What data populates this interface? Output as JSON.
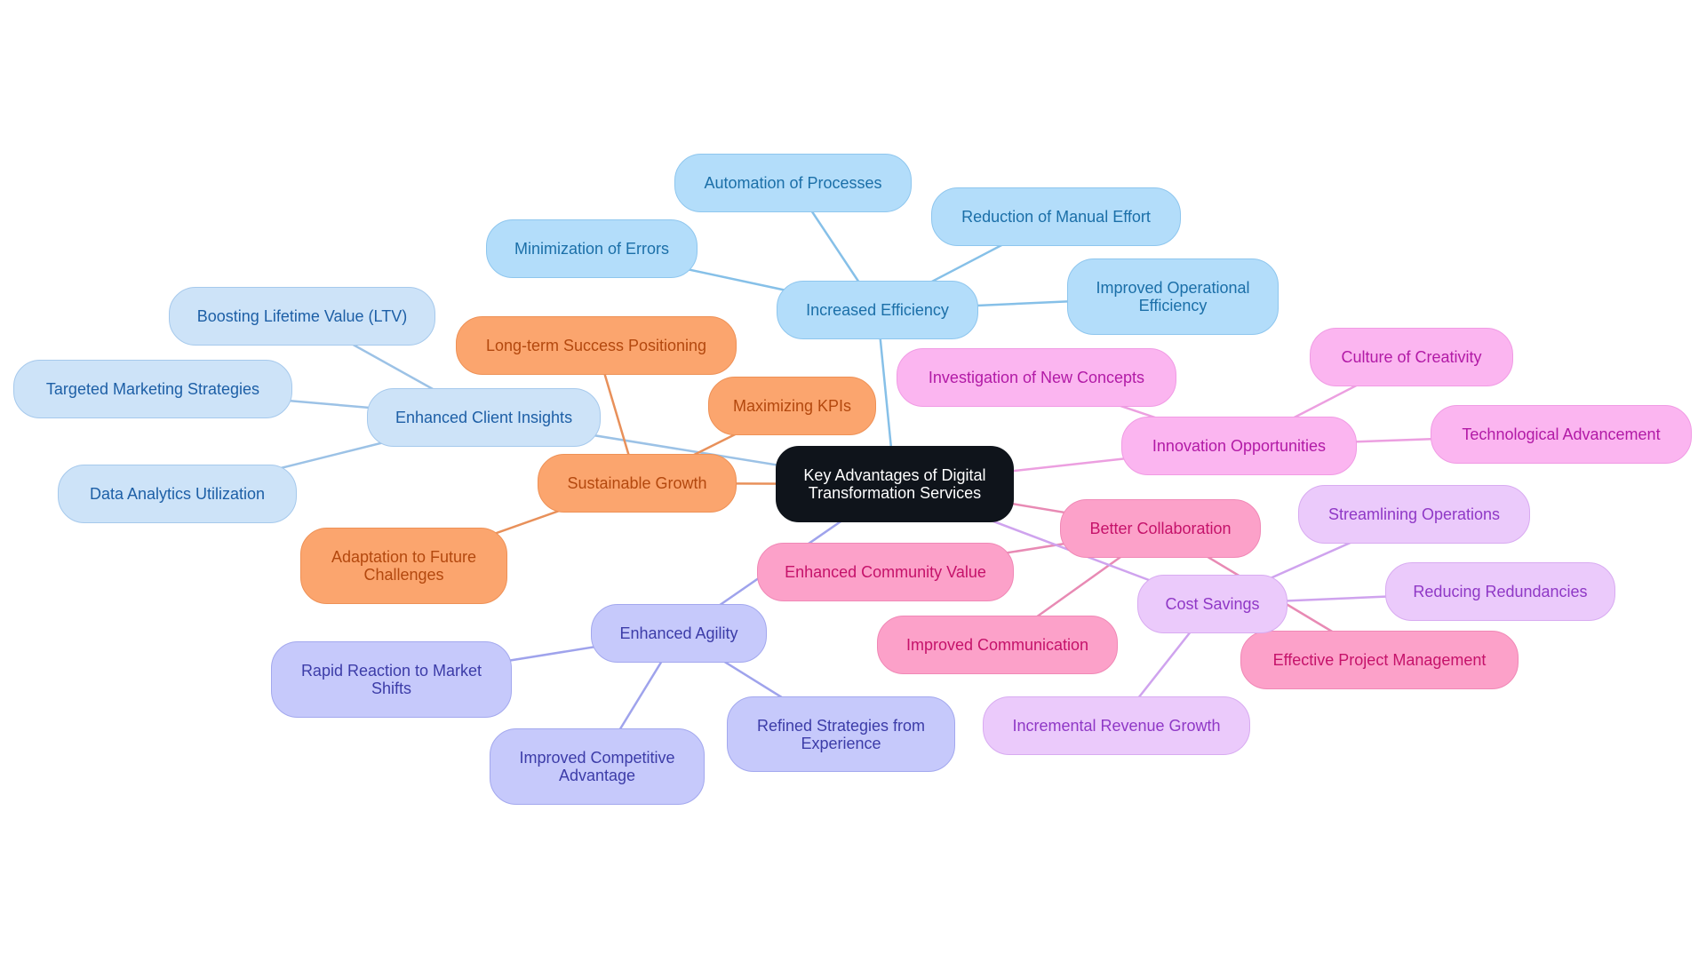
{
  "diagram": {
    "type": "mind-map",
    "root": {
      "id": "root",
      "label": "Key Advantages of Digital\nTransformation Services"
    },
    "colors": {
      "blue": "#b3ddfa",
      "lblue": "#cde3f8",
      "orange": "#fba56e",
      "indigo": "#c6c9fb",
      "magenta": "#fbb5f0",
      "pink": "#fca1c9",
      "lilac": "#ebcafb",
      "root": "#0f141b",
      "edge_blue": "#86c0e8",
      "edge_lblue": "#9cc2e6",
      "edge_orange": "#e8905a",
      "edge_indigo": "#9fa3ec",
      "edge_magenta": "#ec9fe0",
      "edge_pink": "#e88ab4",
      "edge_lilac": "#cfa3ee"
    },
    "nodes": [
      {
        "id": "eff",
        "label": "Increased Efficiency",
        "parent": "root",
        "color": "blue"
      },
      {
        "id": "eff1",
        "label": "Automation of Processes",
        "parent": "eff",
        "color": "blue"
      },
      {
        "id": "eff2",
        "label": "Reduction of Manual Effort",
        "parent": "eff",
        "color": "blue"
      },
      {
        "id": "eff3",
        "label": "Minimization of Errors",
        "parent": "eff",
        "color": "blue"
      },
      {
        "id": "eff4",
        "label": "Improved Operational\nEfficiency",
        "parent": "eff",
        "color": "blue"
      },
      {
        "id": "eci",
        "label": "Enhanced Client Insights",
        "parent": "root",
        "color": "lblue"
      },
      {
        "id": "eci1",
        "label": "Boosting Lifetime Value (LTV)",
        "parent": "eci",
        "color": "lblue"
      },
      {
        "id": "eci2",
        "label": "Targeted Marketing Strategies",
        "parent": "eci",
        "color": "lblue"
      },
      {
        "id": "eci3",
        "label": "Data Analytics Utilization",
        "parent": "eci",
        "color": "lblue"
      },
      {
        "id": "sg",
        "label": "Sustainable Growth",
        "parent": "root",
        "color": "orange"
      },
      {
        "id": "sg1",
        "label": "Long-term Success Positioning",
        "parent": "sg",
        "color": "orange"
      },
      {
        "id": "sg2",
        "label": "Maximizing KPIs",
        "parent": "sg",
        "color": "orange"
      },
      {
        "id": "sg3",
        "label": "Adaptation to Future\nChallenges",
        "parent": "sg",
        "color": "orange"
      },
      {
        "id": "ag",
        "label": "Enhanced Agility",
        "parent": "root",
        "color": "indigo"
      },
      {
        "id": "ag1",
        "label": "Rapid Reaction to Market\nShifts",
        "parent": "ag",
        "color": "indigo"
      },
      {
        "id": "ag2",
        "label": "Improved Competitive\nAdvantage",
        "parent": "ag",
        "color": "indigo"
      },
      {
        "id": "ag3",
        "label": "Refined Strategies from\nExperience",
        "parent": "ag",
        "color": "indigo"
      },
      {
        "id": "inn",
        "label": "Innovation Opportunities",
        "parent": "root",
        "color": "magenta"
      },
      {
        "id": "inn1",
        "label": "Investigation of New Concepts",
        "parent": "inn",
        "color": "magenta"
      },
      {
        "id": "inn2",
        "label": "Culture of Creativity",
        "parent": "inn",
        "color": "magenta"
      },
      {
        "id": "inn3",
        "label": "Technological Advancement",
        "parent": "inn",
        "color": "magenta"
      },
      {
        "id": "bc",
        "label": "Better Collaboration",
        "parent": "root",
        "color": "pink"
      },
      {
        "id": "bc1",
        "label": "Enhanced Community Value",
        "parent": "bc",
        "color": "pink"
      },
      {
        "id": "bc2",
        "label": "Improved Communication",
        "parent": "bc",
        "color": "pink"
      },
      {
        "id": "bc3",
        "label": "Effective Project Management",
        "parent": "bc",
        "color": "pink"
      },
      {
        "id": "cs",
        "label": "Cost Savings",
        "parent": "root",
        "color": "lilac"
      },
      {
        "id": "cs1",
        "label": "Streamlining Operations",
        "parent": "cs",
        "color": "lilac"
      },
      {
        "id": "cs2",
        "label": "Reducing Redundancies",
        "parent": "cs",
        "color": "lilac"
      },
      {
        "id": "cs3",
        "label": "Incremental Revenue Growth",
        "parent": "cs",
        "color": "lilac"
      }
    ]
  }
}
